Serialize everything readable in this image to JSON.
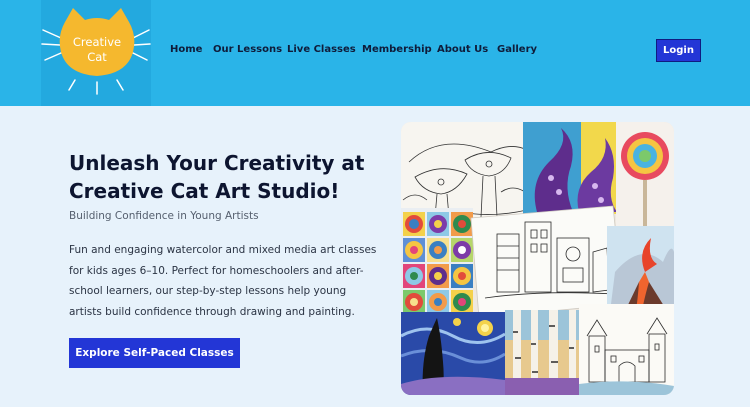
{
  "logo": {
    "line1": "Creative",
    "line2": "Cat"
  },
  "nav": {
    "items": [
      {
        "label": "Home"
      },
      {
        "label": "Our Lessons"
      },
      {
        "label": "Live Classes"
      },
      {
        "label": "Membership"
      },
      {
        "label": "About Us"
      },
      {
        "label": "Gallery"
      }
    ],
    "login_label": "Login"
  },
  "hero": {
    "title": "Unleash Your Creativity at Creative Cat Art Studio!",
    "subtitle": "Building Confidence in Young Artists",
    "description": "Fun and engaging watercolor and mixed media art classes for kids ages 6–10. Perfect for homeschoolers and after-school learners, our step-by-step lessons help young artists build confidence through drawing and painting.",
    "cta_label": "Explore Self-Paced Classes"
  },
  "colors": {
    "header_bg": "#2ab4e8",
    "logo_bg": "#23a9df",
    "logo_cat": "#f5b82e",
    "page_bg": "#e7f2fb",
    "accent": "#2336d6",
    "title_text": "#0d1530"
  }
}
